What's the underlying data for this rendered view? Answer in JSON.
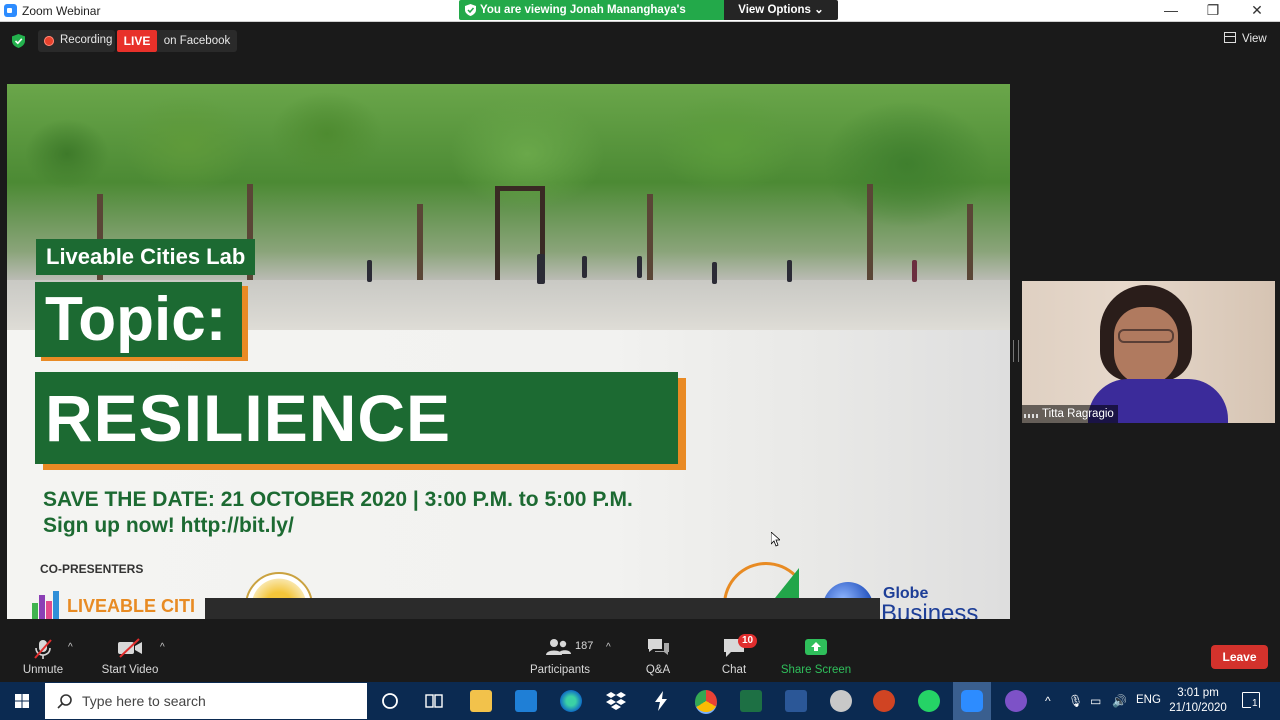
{
  "window": {
    "title": "Zoom Webinar",
    "viewing_banner": "You are viewing Jonah Mananghaya's screen",
    "view_options": "View Options",
    "minimize": "—",
    "restore": "❐",
    "close": "✕"
  },
  "status": {
    "recording": "Recording",
    "live": "LIVE",
    "platform": "on Facebook",
    "view": "View"
  },
  "slide": {
    "lab": "Liveable Cities Lab",
    "topic": "Topic:",
    "theme": "RESILIENCE",
    "save_date": "SAVE THE DATE: 21 OCTOBER 2020 | 3:00 P.M. to 5:00 P.M.",
    "signup": "Sign up now! http://bit.ly/",
    "copresenters": "CO-PRESENTERS",
    "lc_logo_text": "LIVEABLE CITI",
    "globe_text": "Globe",
    "globe_sub": "Business"
  },
  "video": {
    "participant_name": "Titta Ragragio"
  },
  "toolbar": {
    "unmute": "Unmute",
    "start_video": "Start Video",
    "participants": "Participants",
    "participants_count": "187",
    "qa": "Q&A",
    "chat": "Chat",
    "chat_badge": "10",
    "share_screen": "Share Screen",
    "leave": "Leave"
  },
  "taskbar": {
    "search_placeholder": "Type here to search",
    "language": "ENG",
    "time": "3:01 pm",
    "date": "21/10/2020",
    "notifications": "1"
  },
  "colors": {
    "zoom_blue": "#2d8cff",
    "banner_green": "#23a94a",
    "live_red": "#e8312a",
    "slide_green": "#1c6a32",
    "slide_orange": "#e98a24",
    "leave_red": "#d3322c",
    "taskbar": "#0b2a51"
  }
}
